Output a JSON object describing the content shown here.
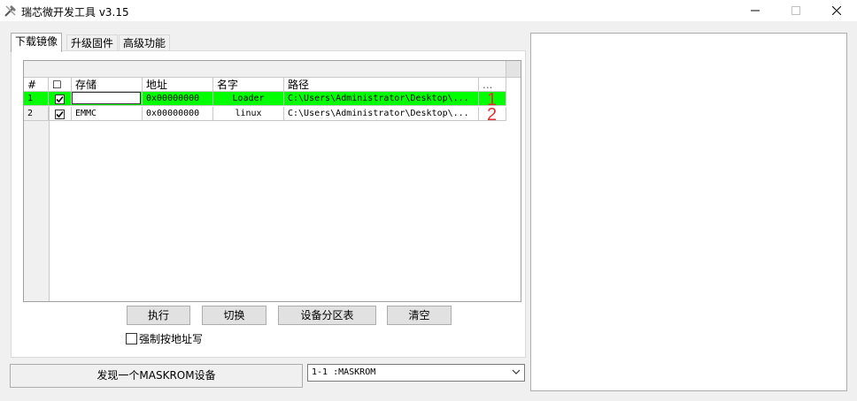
{
  "window": {
    "title": "瑞芯微开发工具 v3.15"
  },
  "tabs": [
    {
      "label": "下载镜像",
      "active": true
    },
    {
      "label": "升级固件",
      "active": false
    },
    {
      "label": "高级功能",
      "active": false
    }
  ],
  "grid": {
    "columns": {
      "index": "#",
      "check": "☐",
      "storage": "存储",
      "address": "地址",
      "name": "名字",
      "path": "路径",
      "more": "..."
    },
    "rows": [
      {
        "index": "1",
        "checked": true,
        "storage": "",
        "address": "0x00000000",
        "name": "Loader",
        "path": "C:\\Users\\Administrator\\Desktop\\...",
        "more": "",
        "selected": true,
        "annotation": "1"
      },
      {
        "index": "2",
        "checked": true,
        "storage": "EMMC",
        "address": "0x00000000",
        "name": "linux",
        "path": "C:\\Users\\Administrator\\Desktop\\...",
        "more": "",
        "selected": false,
        "annotation": "2"
      }
    ]
  },
  "buttons": {
    "run": "执行",
    "switch": "切换",
    "partition": "设备分区表",
    "clear": "清空"
  },
  "force_write": {
    "label": "强制按地址写",
    "checked": false
  },
  "status": {
    "message": "发现一个MASKROM设备"
  },
  "device_select": {
    "value": "1-1 :MASKROM"
  },
  "colors": {
    "selected_row": "#00ff00",
    "annotation": "#e03030"
  }
}
